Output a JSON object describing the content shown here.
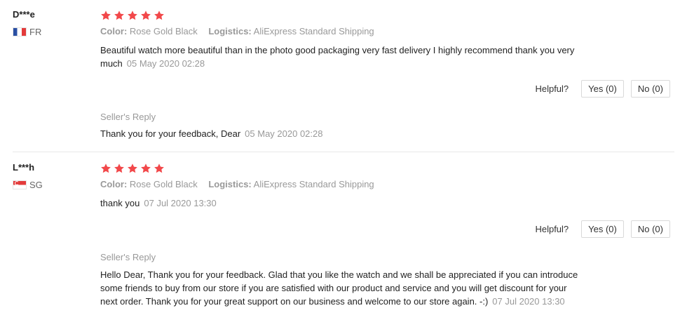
{
  "labels": {
    "color": "Color:",
    "logistics": "Logistics:",
    "helpful": "Helpful?",
    "seller_reply": "Seller's Reply"
  },
  "colors": {
    "star": "#f2484a",
    "muted": "#999999"
  },
  "reviews": [
    {
      "user": "D***e",
      "country": "FR",
      "stars": 5,
      "color_value": "Rose Gold Black",
      "logistics_value": "AliExpress Standard Shipping",
      "text": "Beautiful watch more beautiful than in the photo good packaging very fast delivery I highly recommend thank you very much",
      "date": "05 May 2020 02:28",
      "yes": "Yes (0)",
      "no": "No (0)",
      "reply_text": "Thank you for your feedback, Dear",
      "reply_date": "05 May 2020 02:28"
    },
    {
      "user": "L***h",
      "country": "SG",
      "stars": 5,
      "color_value": "Rose Gold Black",
      "logistics_value": "AliExpress Standard Shipping",
      "text": "thank you",
      "date": "07 Jul 2020 13:30",
      "yes": "Yes (0)",
      "no": "No (0)",
      "reply_text": "Hello Dear, Thank you for your feedback. Glad that you like the watch and we shall be appreciated if you can introduce some friends to buy from our store if you are satisfied with our product and service and you will get discount for your next order. Thank you for your great support on our business and welcome to our store again. -:)",
      "reply_date": "07 Jul 2020 13:30"
    }
  ]
}
